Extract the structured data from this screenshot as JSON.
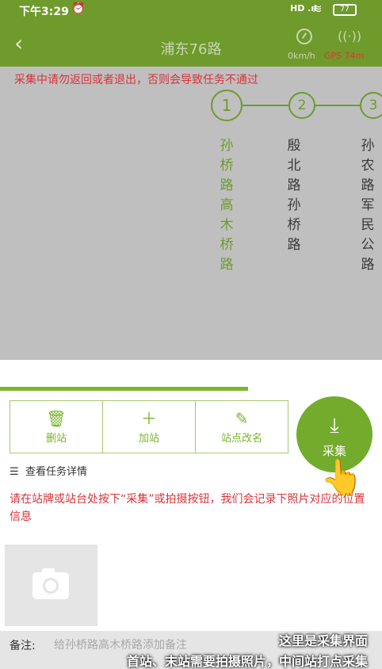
{
  "status_bar": {
    "time": "下午3:29",
    "alarm_icon": "alarm-icon",
    "signal": "HD .ıl",
    "wifi_icon": "wifi-icon",
    "battery": "77"
  },
  "header": {
    "back_icon": "chevron-left-icon",
    "title": "浦东76路",
    "speed": "0km/h",
    "gps": "GPS 74m"
  },
  "warning": "采集中请勿返回或者退出，否则会导致任务不通过",
  "stations": [
    {
      "number": "1",
      "name": "孙桥路高木桥路"
    },
    {
      "number": "2",
      "name": "殷北路孙桥路"
    },
    {
      "number": "3",
      "name": "孙农路军民公路"
    }
  ],
  "progress": {
    "fraction": 0.65
  },
  "actions": {
    "delete": {
      "icon": "trash-icon",
      "label": "删站"
    },
    "add": {
      "icon": "plus-icon",
      "label": "加站"
    },
    "rename": {
      "icon": "edit-icon",
      "label": "站点改名"
    }
  },
  "collect": {
    "icon": "download-icon",
    "label": "采集"
  },
  "details_link": "查看任务详情",
  "instruction": "请在站牌或站台处按下“采集”或拍摄按钮，我们会记录下照片对应的位置信息",
  "photo": {
    "icon": "camera-icon"
  },
  "remark": {
    "label": "备注:",
    "placeholder": "给孙桥路高木桥路添加备注",
    "value": ""
  },
  "caption": {
    "line1": "这里是采集界面",
    "line2": "首站、末站需要拍摄照片，中间站打点采集"
  },
  "colors": {
    "header_green": "#6f9a2c",
    "accent_green": "#7ab52c",
    "warning_red": "#d9333a",
    "overlay_gray": "#bfbfbf"
  }
}
